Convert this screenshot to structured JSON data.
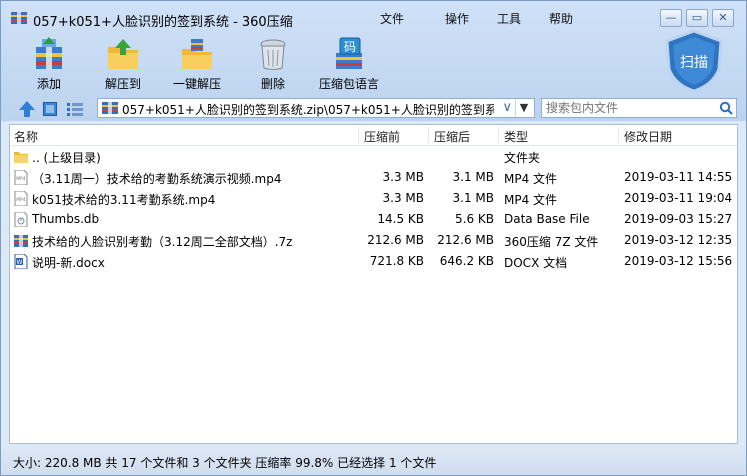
{
  "window": {
    "title": "057+k051+人脸识别的签到系统 - 360压缩",
    "menu": [
      "文件",
      "操作",
      "工具",
      "帮助"
    ],
    "buttons": [
      "—",
      "▭",
      "✕"
    ]
  },
  "toolbar": {
    "add": "添加",
    "extract_to": "解压到",
    "one_click_extract": "一键解压",
    "delete": "删除",
    "compress_encoding": "压缩包语言",
    "encoding_badge": "码",
    "scan": "扫描"
  },
  "address": {
    "path": "057+k051+人脸识别的签到系统.zip\\057+k051+人脸识别的签到系统",
    "search_placeholder": "搜索包内文件"
  },
  "columns": {
    "name": "名称",
    "size_before": "压缩前",
    "size_after": "压缩后",
    "type": "类型",
    "modified": "修改日期"
  },
  "files": [
    {
      "icon": "folder-up-icon",
      "name": "..  (上级目录)",
      "before": "",
      "after": "",
      "type": "文件夹",
      "date": ""
    },
    {
      "icon": "mp4-file-icon",
      "name": "（3.11周一）技术给的考勤系统演示视频.mp4",
      "before": "3.3 MB",
      "after": "3.1 MB",
      "type": "MP4 文件",
      "date": "2019-03-11 14:55"
    },
    {
      "icon": "mp4-file-icon",
      "name": "k051技术给的3.11考勤系统.mp4",
      "before": "3.3 MB",
      "after": "3.1 MB",
      "type": "MP4 文件",
      "date": "2019-03-11 19:04"
    },
    {
      "icon": "db-file-icon",
      "name": "Thumbs.db",
      "before": "14.5 KB",
      "after": "5.6 KB",
      "type": "Data Base File",
      "date": "2019-09-03 15:27"
    },
    {
      "icon": "7z-archive-icon",
      "name": "技术给的人脸识别考勤（3.12周二全部文档）.7z",
      "before": "212.6 MB",
      "after": "212.6 MB",
      "type": "360压缩 7Z 文件",
      "date": "2019-03-12 12:35"
    },
    {
      "icon": "docx-file-icon",
      "name": "说明-新.docx",
      "before": "721.8 KB",
      "after": "646.2 KB",
      "type": "DOCX 文档",
      "date": "2019-03-12 15:56"
    }
  ],
  "status": "大小: 220.8 MB 共 17 个文件和 3 个文件夹 压缩率 99.8% 已经选择 1 个文件",
  "colors": {
    "accent": "#2f74c0",
    "window_bg": "#cfe1f7",
    "list_bg": "#ffffff"
  }
}
